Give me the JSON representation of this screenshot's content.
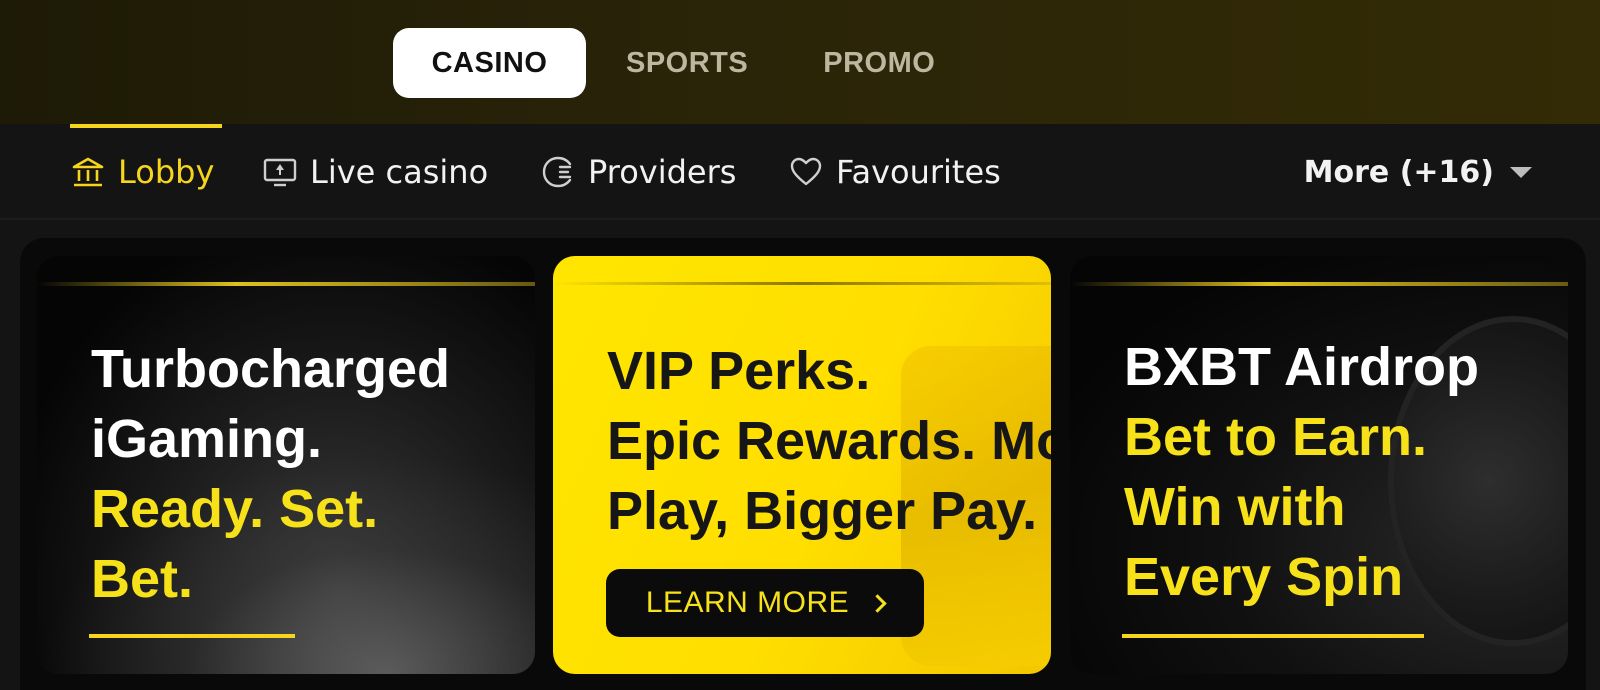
{
  "header": {
    "tabs": [
      {
        "label": "CASINO",
        "active": true
      },
      {
        "label": "SPORTS",
        "active": false
      },
      {
        "label": "PROMO",
        "active": false
      }
    ]
  },
  "subnav": {
    "items": [
      {
        "label": "Lobby",
        "icon": "bank-icon",
        "active": true
      },
      {
        "label": "Live casino",
        "icon": "monitor-icon",
        "active": false
      },
      {
        "label": "Providers",
        "icon": "providers-icon",
        "active": false
      },
      {
        "label": "Favourites",
        "icon": "heart-icon",
        "active": false
      }
    ],
    "more_label": "More (+16)"
  },
  "banners": [
    {
      "line1": "Turbocharged",
      "line2": "iGaming.",
      "line3": "Ready. Set.",
      "line4": "Bet."
    },
    {
      "line1": "VIP Perks.",
      "line2": "Epic Rewards. Mo",
      "line3": "Play, Bigger Pay.",
      "button_label": "LEARN MORE"
    },
    {
      "line1": "BXBT Airdrop",
      "line2": "Bet to Earn.",
      "line3": "Win with",
      "line4": "Every Spin"
    }
  ],
  "colors": {
    "accent": "#f7d51c",
    "background": "#141414",
    "banner_yellow": "#ffe600"
  }
}
